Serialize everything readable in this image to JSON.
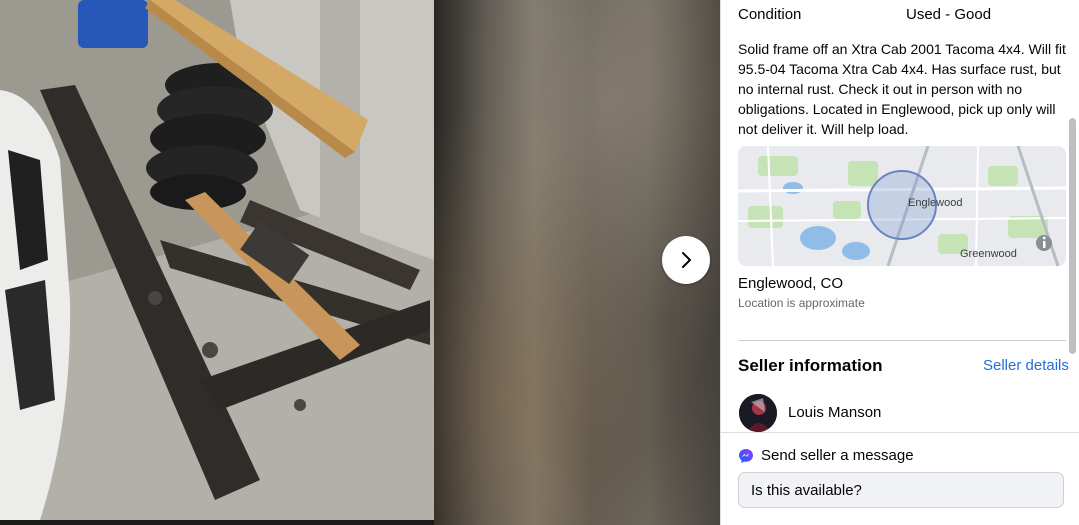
{
  "listing": {
    "condition_label": "Condition",
    "condition_value": "Used - Good",
    "description": "Solid frame off an Xtra Cab 2001 Tacoma 4x4. Will fit 95.5-04 Tacoma Xtra Cab 4x4. Has surface rust, but no internal rust. Check it out in person with no obligations. Located in Englewood, pick up only will not deliver it. Will help load.",
    "map_labels": {
      "city": "Englewood",
      "nearby": "Greenwood"
    },
    "location_title": "Englewood, CO",
    "location_note": "Location is approximate"
  },
  "seller": {
    "heading": "Seller information",
    "details_link": "Seller details",
    "name": "Louis Manson"
  },
  "message": {
    "heading": "Send seller a message",
    "input_value": "Is this available?"
  },
  "icons": {
    "next": "chevron-right-icon",
    "messenger": "messenger-icon",
    "info": "info-icon"
  },
  "colors": {
    "link": "#216fdb",
    "messenger_gradient_start": "#0866ff",
    "messenger_gradient_end": "#a033ff"
  }
}
